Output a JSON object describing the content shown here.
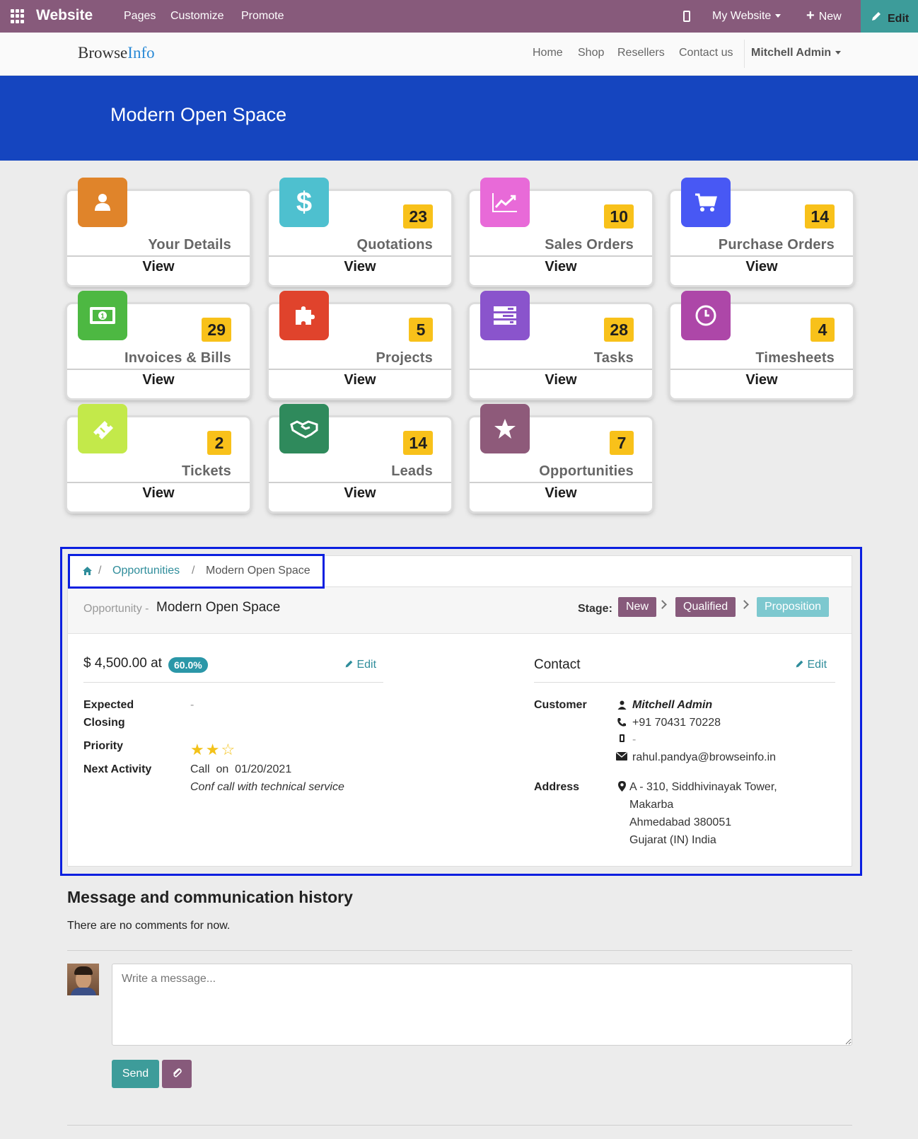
{
  "topbar": {
    "brand": "Website",
    "menu": [
      "Pages",
      "Customize",
      "Promote"
    ],
    "my_website": "My Website",
    "new": "New",
    "edit": "Edit"
  },
  "site": {
    "logo_a": "Browse",
    "logo_b": "Info",
    "nav": [
      "Home",
      "Shop",
      "Resellers",
      "Contact us"
    ],
    "user": "Mitchell Admin"
  },
  "hero_title": "Modern Open Space",
  "cards": [
    {
      "title": "Your Details",
      "count": "",
      "view": "View",
      "color": "#e0842a",
      "icon": "user-icon"
    },
    {
      "title": "Quotations",
      "count": "23",
      "view": "View",
      "color": "#4ec0cf",
      "icon": "dollar-icon"
    },
    {
      "title": "Sales Orders",
      "count": "10",
      "view": "View",
      "color": "#e86ad8",
      "icon": "line-chart-icon"
    },
    {
      "title": "Purchase Orders",
      "count": "14",
      "view": "View",
      "color": "#4858f4",
      "icon": "cart-icon"
    },
    {
      "title": "Invoices & Bills",
      "count": "29",
      "view": "View",
      "color": "#4db842",
      "icon": "money-icon"
    },
    {
      "title": "Projects",
      "count": "5",
      "view": "View",
      "color": "#e0432c",
      "icon": "puzzle-icon"
    },
    {
      "title": "Tasks",
      "count": "28",
      "view": "View",
      "color": "#8a54cc",
      "icon": "tasks-icon"
    },
    {
      "title": "Timesheets",
      "count": "4",
      "view": "View",
      "color": "#ad47a8",
      "icon": "clock-icon"
    },
    {
      "title": "Tickets",
      "count": "2",
      "view": "View",
      "color": "#c3e94a",
      "icon": "ticket-icon"
    },
    {
      "title": "Leads",
      "count": "14",
      "view": "View",
      "color": "#2f8a5c",
      "icon": "handshake-icon"
    },
    {
      "title": "Opportunities",
      "count": "7",
      "view": "View",
      "color": "#8e5a7a",
      "icon": "star-icon"
    }
  ],
  "breadcrumb": {
    "link": "Opportunities",
    "current": "Modern Open Space"
  },
  "opportunity": {
    "kind": "Opportunity -",
    "name": "Modern Open Space",
    "stage_label": "Stage:",
    "stages": [
      {
        "label": "New",
        "color": "#875a7b"
      },
      {
        "label": "Qualified",
        "color": "#875a7b"
      },
      {
        "label": "Proposition",
        "color": "#7dc8cf"
      }
    ],
    "amount": "$ 4,500.00 at",
    "probability": "60.0%",
    "edit": "Edit",
    "expected_closing_label_1": "Expected",
    "expected_closing_label_2": "Closing",
    "expected_closing": "-",
    "priority_label": "Priority",
    "priority_stars": 2,
    "priority_max": 3,
    "next_activity_label": "Next Activity",
    "next_activity": "Call  on  01/20/2021",
    "next_activity_note": "Conf call with technical service"
  },
  "contact": {
    "title": "Contact",
    "edit": "Edit",
    "customer_label": "Customer",
    "customer": "Mitchell Admin",
    "phone": "+91 70431 70228",
    "mobile": "-",
    "email": "rahul.pandya@browseinfo.in",
    "address_label": "Address",
    "address_lines": [
      "A - 310, Siddhivinayak Tower,",
      "Makarba",
      "Ahmedabad 380051",
      "Gujarat (IN) India"
    ]
  },
  "messages": {
    "title": "Message and communication history",
    "empty": "There are no comments for now.",
    "placeholder": "Write a message...",
    "send": "Send"
  }
}
